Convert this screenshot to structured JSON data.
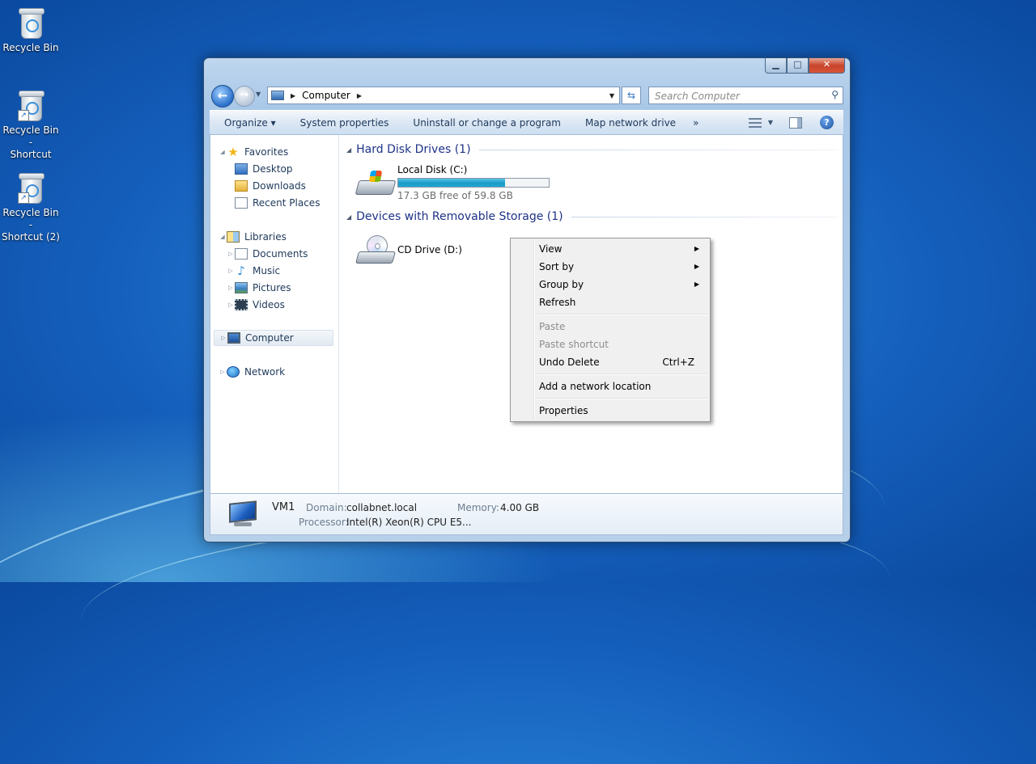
{
  "desktop": {
    "icons": [
      {
        "label_line1": "Recycle Bin",
        "label_line2": ""
      },
      {
        "label_line1": "Recycle Bin -",
        "label_line2": "Shortcut"
      },
      {
        "label_line1": "Recycle Bin -",
        "label_line2": "Shortcut (2)"
      }
    ]
  },
  "window": {
    "caption": {
      "minimize": "▁",
      "maximize": "□",
      "close": "✕"
    },
    "address": {
      "crumb": "Computer"
    },
    "search": {
      "placeholder": "Search Computer"
    },
    "toolbar": {
      "organize": "Organize ▾",
      "system_properties": "System properties",
      "uninstall": "Uninstall or change a program",
      "map_drive": "Map network drive",
      "more": "»"
    },
    "nav": {
      "favorites": "Favorites",
      "desktop": "Desktop",
      "downloads": "Downloads",
      "recent_places": "Recent Places",
      "libraries": "Libraries",
      "documents": "Documents",
      "music": "Music",
      "pictures": "Pictures",
      "videos": "Videos",
      "computer": "Computer",
      "network": "Network"
    },
    "groups": {
      "hard_disk": "Hard Disk Drives (1)",
      "removable": "Devices with Removable Storage (1)"
    },
    "drives": {
      "c_name": "Local Disk (C:)",
      "c_free": "17.3 GB free of 59.8 GB",
      "c_used_fraction": 0.71,
      "d_name": "CD Drive (D:)"
    },
    "details": {
      "name": "VM1",
      "domain_label": "Domain:",
      "domain_value": "collabnet.local",
      "memory_label": "Memory:",
      "memory_value": "4.00 GB",
      "processor_label": "Processor:",
      "processor_value": "Intel(R) Xeon(R) CPU E5..."
    }
  },
  "context_menu": {
    "view": "View",
    "sort_by": "Sort by",
    "group_by": "Group by",
    "refresh": "Refresh",
    "paste": "Paste",
    "paste_shortcut": "Paste shortcut",
    "undo_delete": "Undo Delete",
    "undo_shortcut": "Ctrl+Z",
    "add_network_location": "Add a network location",
    "properties": "Properties"
  }
}
